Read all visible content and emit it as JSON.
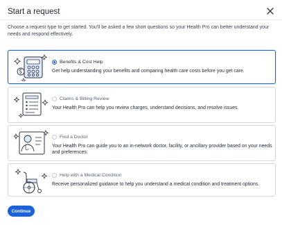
{
  "header": {
    "title": "Start a request"
  },
  "intro": "Choose a request type to get started. You'll be asked a few short questions so your Health Pro can better understand your needs and respond effectively.",
  "options": [
    {
      "label": "Benefits & Cost Help",
      "description": "Get help understanding your benefits and comparing health care costs before you get care.",
      "selected": true,
      "icon": "calculator-icon"
    },
    {
      "label": "Claims & Billing Review",
      "description": "Your Health Pro can help you review charges, understand decisions, and resolve issues.",
      "selected": false,
      "icon": "document-list-icon"
    },
    {
      "label": "Find a Doctor",
      "description": "Your Health Pro can guide you to an in-network doctor, facility, or ancillary provider based on your needs and preferences.",
      "selected": false,
      "icon": "doctor-card-icon"
    },
    {
      "label": "Help with a Medical Condition",
      "description": "Receive personalized guidance to help you understand a medical condition and treatment options.",
      "selected": false,
      "icon": "wheelchair-icon"
    }
  ],
  "continue_label": "Continue",
  "colors": {
    "accent": "#1b63d6",
    "border": "#d5d9de",
    "text": "#1f2733"
  }
}
